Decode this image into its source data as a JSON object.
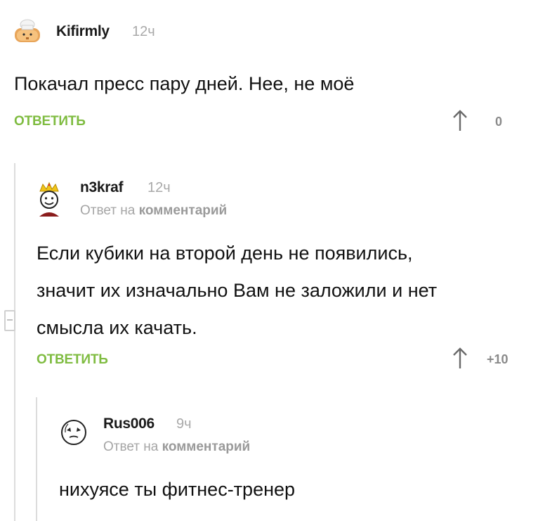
{
  "comments": [
    {
      "username": "Kifirmly",
      "time": "12ч",
      "text": "Покачал пресс пару дней. Нее, не моё",
      "reply_label": "ОТВЕТИТЬ",
      "score": "0"
    },
    {
      "username": "n3kraf",
      "time": "12ч",
      "reply_to_prefix": "Ответ на",
      "reply_to_target": "комментарий",
      "text_lines": [
        "Если кубики на второй день не появились,",
        "значит их изначально Вам не заложили и нет",
        "смысла их качать."
      ],
      "reply_label": "ОТВЕТИТЬ",
      "score": "+10"
    },
    {
      "username": "Rus006",
      "time": "9ч",
      "reply_to_prefix": "Ответ на",
      "reply_to_target": "комментарий",
      "text": "нихуясе ты фитнес-тренер"
    }
  ],
  "icons": {
    "upvote": "arrow-up-icon",
    "collapse": "collapse-thread-icon"
  },
  "colors": {
    "reply_action": "#7fbc41",
    "meta_text": "#a5a5a5",
    "thread_line": "#dcdcdc"
  }
}
